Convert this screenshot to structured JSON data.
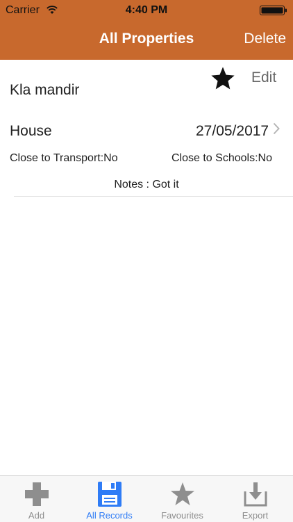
{
  "status_bar": {
    "carrier": "Carrier",
    "time": "4:40 PM"
  },
  "nav": {
    "title": "All Properties",
    "delete_label": "Delete"
  },
  "record": {
    "name": "Kla mandir",
    "edit_label": "Edit",
    "favourite": true,
    "type": "House",
    "date": "27/05/2017",
    "transport": "Close to Transport:No",
    "schools": "Close to Schools:No",
    "notes": "Notes : Got it"
  },
  "tabs": [
    {
      "label": "Add",
      "icon": "plus-icon",
      "active": false
    },
    {
      "label": "All Records",
      "icon": "floppy-disk-icon",
      "active": true
    },
    {
      "label": "Favourites",
      "icon": "star-icon",
      "active": false
    },
    {
      "label": "Export",
      "icon": "export-icon",
      "active": false
    }
  ],
  "colors": {
    "nav_background": "#c8692d",
    "active_tab": "#2f7cf6",
    "inactive_tab": "#8e8e8e"
  }
}
